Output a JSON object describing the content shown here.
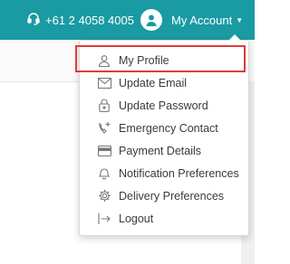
{
  "header": {
    "phone": "+61 2 4058 4005",
    "account_label": "My Account",
    "colors": {
      "bar": "#1a9aa3",
      "highlight": "#e03a3a"
    }
  },
  "menu": {
    "items": [
      {
        "label": "My Profile",
        "icon": "user-icon"
      },
      {
        "label": "Update Email",
        "icon": "envelope-icon"
      },
      {
        "label": "Update Password",
        "icon": "lock-icon"
      },
      {
        "label": "Emergency Contact",
        "icon": "phone-plus-icon"
      },
      {
        "label": "Payment Details",
        "icon": "credit-card-icon"
      },
      {
        "label": "Notification Preferences",
        "icon": "bell-icon"
      },
      {
        "label": "Delivery Preferences",
        "icon": "gear-icon"
      },
      {
        "label": "Logout",
        "icon": "logout-icon"
      }
    ]
  }
}
